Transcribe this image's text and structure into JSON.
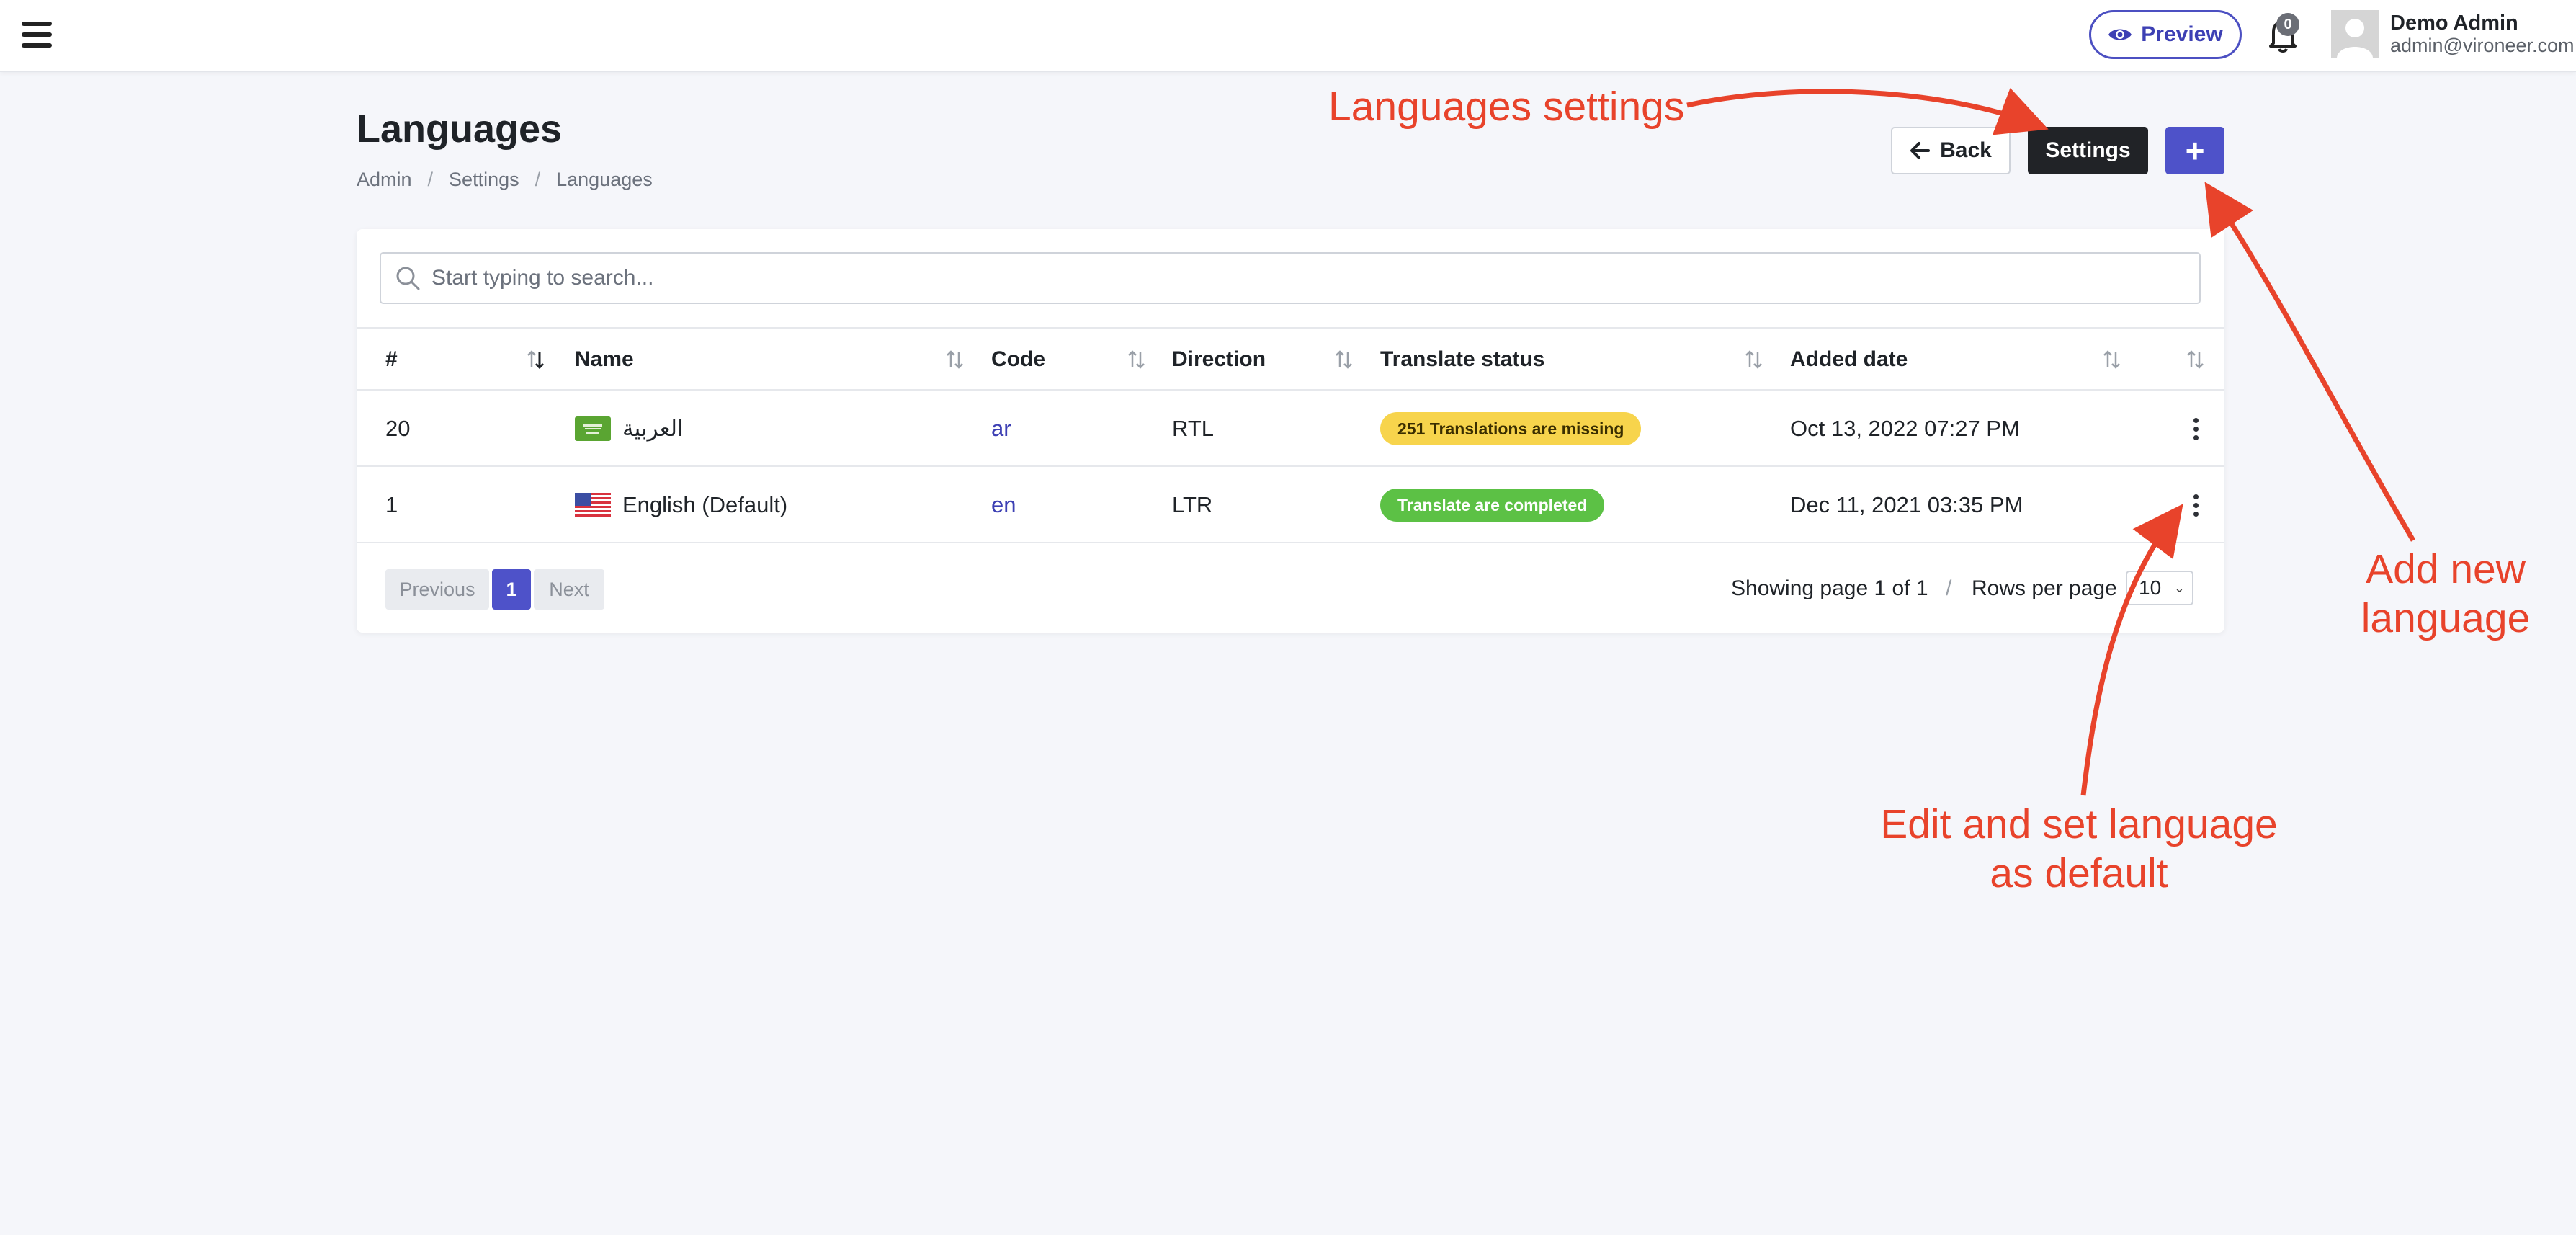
{
  "header": {
    "preview_label": "Preview",
    "notification_count": "0",
    "user_name": "Demo Admin",
    "user_email": "admin@vironeer.com"
  },
  "page": {
    "title": "Languages",
    "breadcrumb": [
      "Admin",
      "Settings",
      "Languages"
    ],
    "back_label": "Back",
    "settings_label": "Settings",
    "add_label": "+"
  },
  "search": {
    "placeholder": "Start typing to search..."
  },
  "table": {
    "columns": [
      "#",
      "Name",
      "Code",
      "Direction",
      "Translate status",
      "Added date"
    ],
    "rows": [
      {
        "id": "20",
        "name": "العربية",
        "flag": "saudi-arabia-flag",
        "code": "ar",
        "direction": "RTL",
        "status": "251 Translations are missing",
        "status_color": "#f7d44c",
        "added": "Oct 13, 2022 07:27 PM"
      },
      {
        "id": "1",
        "name": "English (Default)",
        "flag": "usa-flag",
        "code": "en",
        "direction": "LTR",
        "status": "Translate are completed",
        "status_color": "#5cc145",
        "added": "Dec 11, 2021 03:35 PM"
      }
    ]
  },
  "pagination": {
    "previous": "Previous",
    "current": "1",
    "next": "Next",
    "showing": "Showing page 1 of 1",
    "separator": "/",
    "rows_per_page_label": "Rows per page",
    "rows_per_page_value": "10"
  },
  "annotations": {
    "languages_settings": "Languages settings",
    "add_new_language": [
      "Add new",
      "language"
    ],
    "edit_set_default": [
      "Edit and set language",
      "as default"
    ]
  },
  "colors": {
    "accent": "#4e52c9",
    "annotation": "#e8432b",
    "dark_button": "#212327"
  }
}
